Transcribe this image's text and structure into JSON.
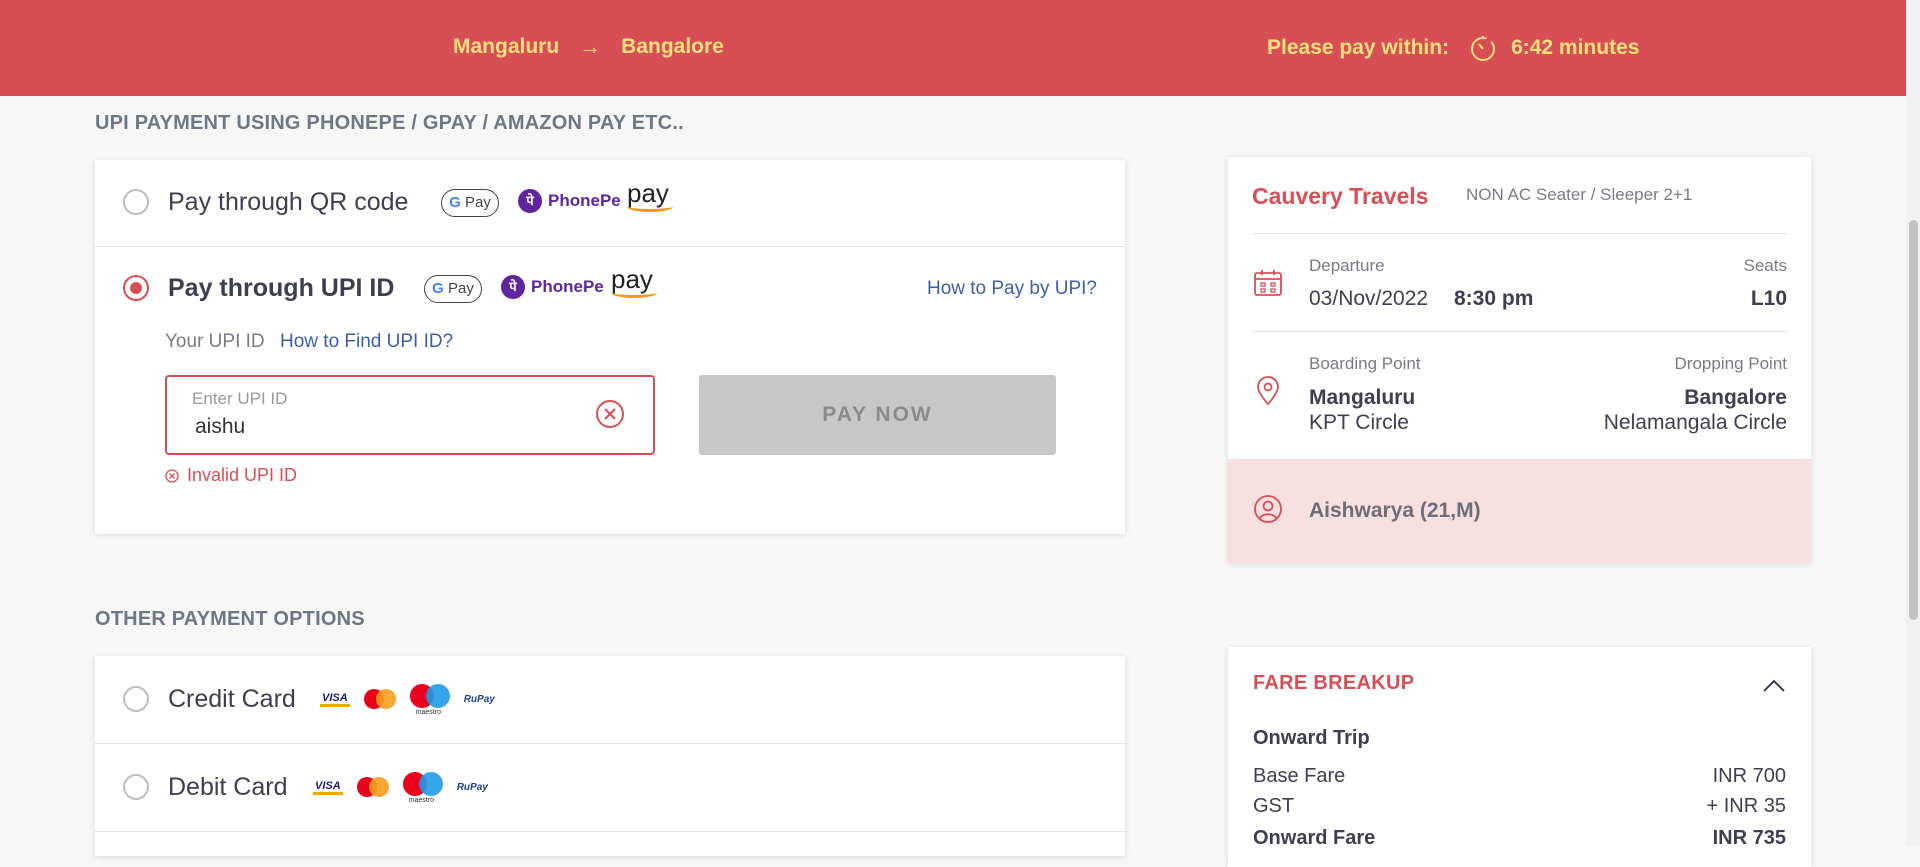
{
  "header": {
    "from": "Mangaluru",
    "to": "Bangalore",
    "timer_label": "Please pay within:",
    "timer_value": "6:42 minutes"
  },
  "upi_section": {
    "title": "UPI PAYMENT USING PHONEPE / GPAY / AMAZON PAY ETC..",
    "qr_option_label": "Pay through QR code",
    "upi_option_label": "Pay through UPI ID",
    "how_to_pay_link": "How to Pay by UPI?",
    "your_upi_label": "Your UPI ID",
    "how_to_find_link": "How to Find UPI ID?",
    "input_placeholder": "Enter UPI ID",
    "input_value": "aishu",
    "pay_button": "PAY NOW",
    "error_text": "Invalid UPI ID",
    "logos": {
      "gpay": "G Pay",
      "phonepe": "PhonePe",
      "amazon": "pay"
    }
  },
  "other_section": {
    "title": "OTHER PAYMENT OPTIONS",
    "options": [
      {
        "label": "Credit Card"
      },
      {
        "label": "Debit Card"
      }
    ],
    "card_logos": {
      "visa": "VISA",
      "maestro": "maestro",
      "rupay": "RuPay"
    }
  },
  "trip": {
    "operator": "Cauvery Travels",
    "bus_type": "NON AC Seater / Sleeper 2+1",
    "departure_label": "Departure",
    "departure_date": "03/Nov/2022",
    "departure_time": "8:30 pm",
    "seats_label": "Seats",
    "seats_value": "L10",
    "boarding_label": "Boarding Point",
    "boarding_city": "Mangaluru",
    "boarding_place": "KPT Circle",
    "dropping_label": "Dropping Point",
    "dropping_city": "Bangalore",
    "dropping_place": "Nelamangala Circle",
    "passenger": "Aishwarya (21,M)"
  },
  "fare": {
    "title": "FARE BREAKUP",
    "onward_trip": "Onward Trip",
    "base_fare_label": "Base Fare",
    "base_fare_value": "INR 700",
    "gst_label": "GST",
    "gst_value": "+ INR 35",
    "onward_fare_label": "Onward Fare",
    "onward_fare_value": "INR 735"
  },
  "colors": {
    "primary": "#d84e55",
    "accent_text": "#ffe07a",
    "link": "#3d5fa8"
  },
  "icons": [
    "arrow-right-icon",
    "clock-icon",
    "calendar-icon",
    "location-pin-icon",
    "user-icon",
    "chevron-up-icon",
    "clear-icon",
    "error-icon"
  ]
}
